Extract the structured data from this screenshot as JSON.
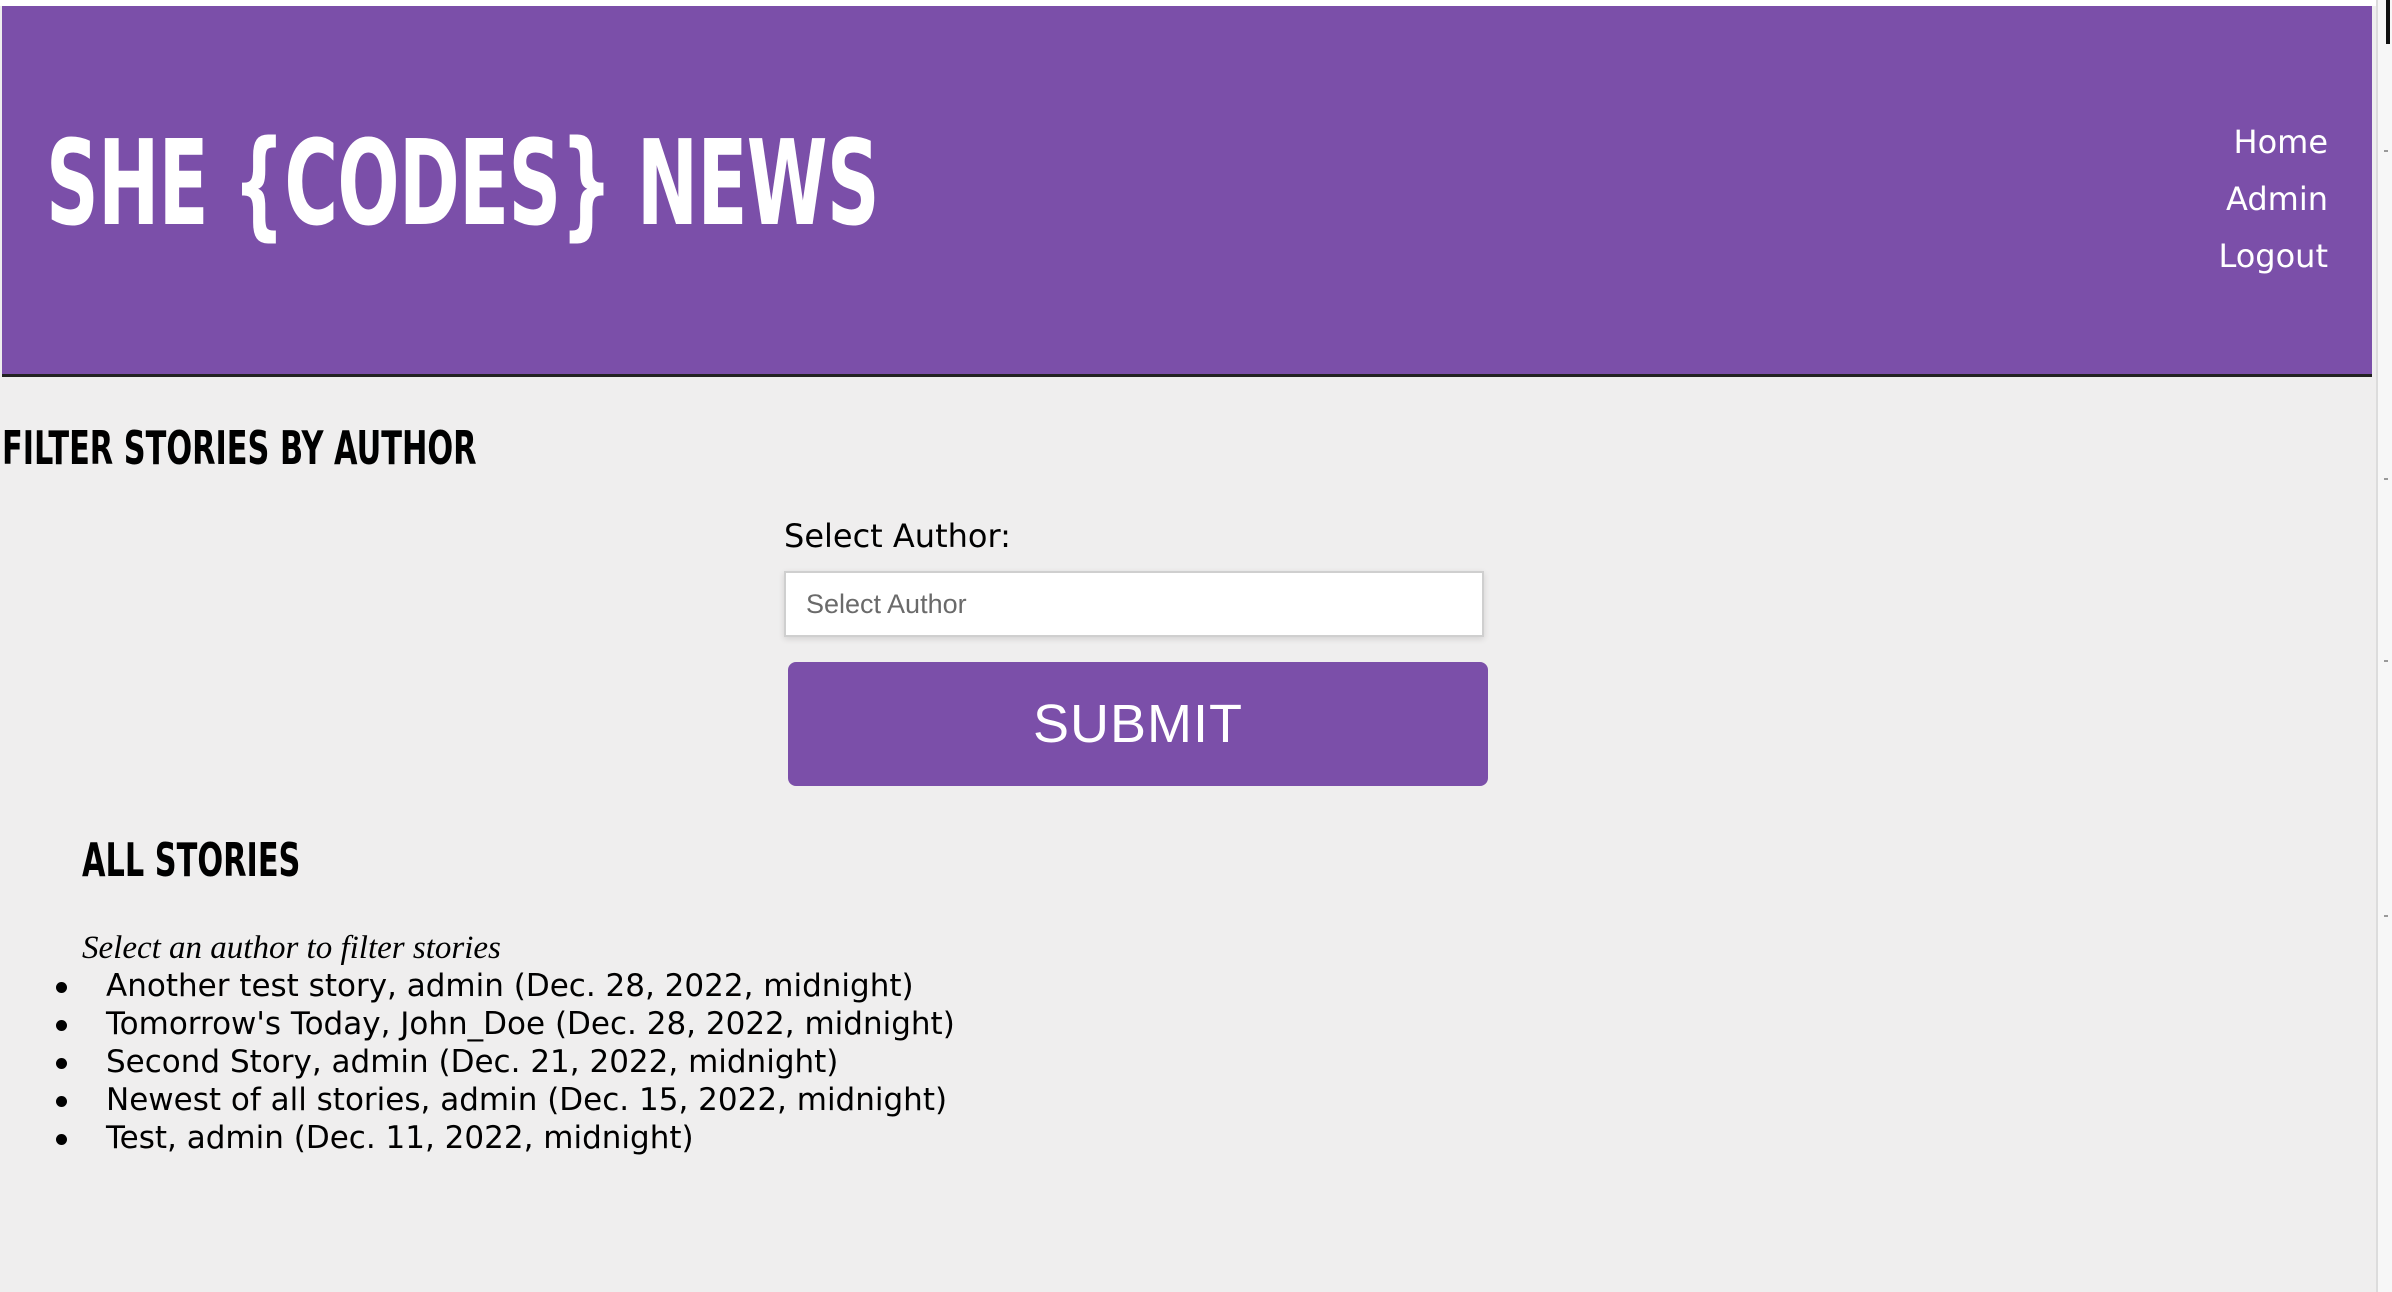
{
  "header": {
    "logo": "SHE {CODES} NEWS",
    "nav": [
      "Home",
      "Admin",
      "Logout"
    ]
  },
  "filter": {
    "heading": "FILTER STORIES BY AUTHOR",
    "label": "Select Author:",
    "placeholder": "Select Author",
    "submit_label": "SUBMIT"
  },
  "stories": {
    "heading": "ALL STORIES",
    "hint": "Select an author to filter stories",
    "items": [
      "Another test story, admin (Dec. 28, 2022, midnight)",
      "Tomorrow's Today, John_Doe (Dec. 28, 2022, midnight)",
      "Second Story, admin (Dec. 21, 2022, midnight)",
      "Newest of all stories, admin (Dec. 15, 2022, midnight)",
      "Test, admin (Dec. 11, 2022, midnight)"
    ]
  },
  "colors": {
    "brand": "#7b4fa9",
    "background": "#efeeee",
    "header_text": "#ffffff"
  }
}
